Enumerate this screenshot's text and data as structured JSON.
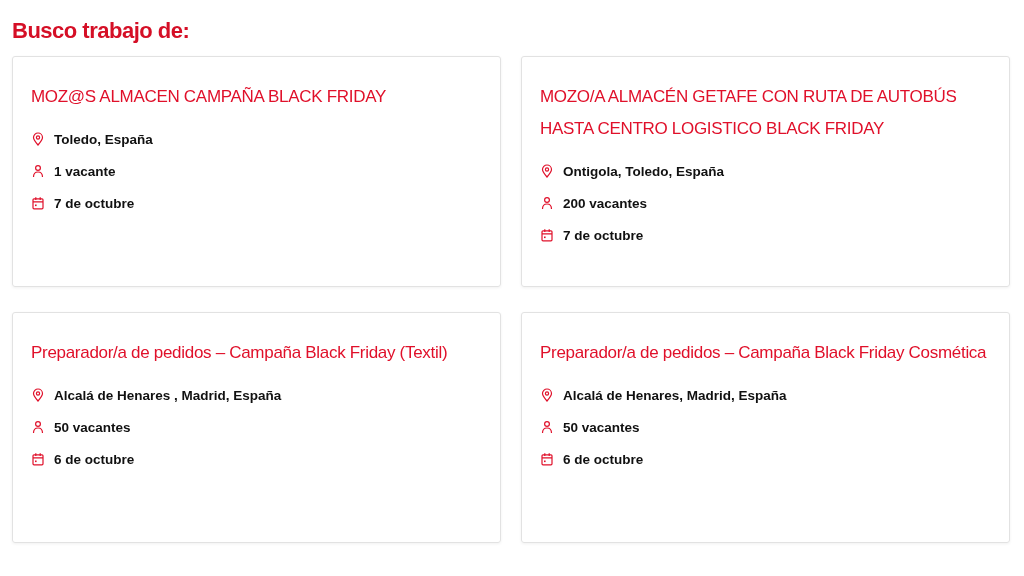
{
  "heading": "Busco trabajo de:",
  "jobs": [
    {
      "title": "MOZ@S ALMACEN CAMPAÑA BLACK FRIDAY",
      "location": "Toledo, España",
      "vacancies": "1 vacante",
      "date": "7 de octubre"
    },
    {
      "title": "MOZO/A ALMACÉN GETAFE CON RUTA DE AUTOBÚS HASTA CENTRO LOGISTICO BLACK FRIDAY",
      "location": "Ontigola, Toledo, España",
      "vacancies": "200 vacantes",
      "date": "7 de octubre"
    },
    {
      "title": "Preparador/a de pedidos – Campaña Black Friday (Textil)",
      "location": "Alcalá de Henares , Madrid, España",
      "vacancies": "50 vacantes",
      "date": "6 de octubre"
    },
    {
      "title": "Preparador/a de pedidos – Campaña Black Friday Cosmética",
      "location": "Alcalá de Henares, Madrid, España",
      "vacancies": "50 vacantes",
      "date": "6 de octubre"
    }
  ]
}
